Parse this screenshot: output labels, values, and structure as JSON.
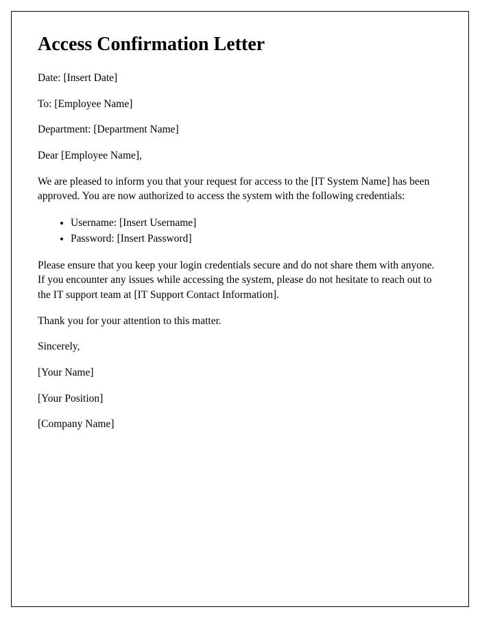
{
  "title": "Access Confirmation Letter",
  "date_line": "Date: [Insert Date]",
  "to_line": "To: [Employee Name]",
  "department_line": "Department: [Department Name]",
  "salutation": "Dear [Employee Name],",
  "body_paragraph_1": "We are pleased to inform you that your request for access to the [IT System Name] has been approved. You are now authorized to access the system with the following credentials:",
  "credentials": {
    "username": "Username: [Insert Username]",
    "password": "Password: [Insert Password]"
  },
  "body_paragraph_2": "Please ensure that you keep your login credentials secure and do not share them with anyone. If you encounter any issues while accessing the system, please do not hesitate to reach out to the IT support team at [IT Support Contact Information].",
  "thank_you": "Thank you for your attention to this matter.",
  "closing": "Sincerely,",
  "signature_name": "[Your Name]",
  "signature_position": "[Your Position]",
  "company_name": "[Company Name]"
}
